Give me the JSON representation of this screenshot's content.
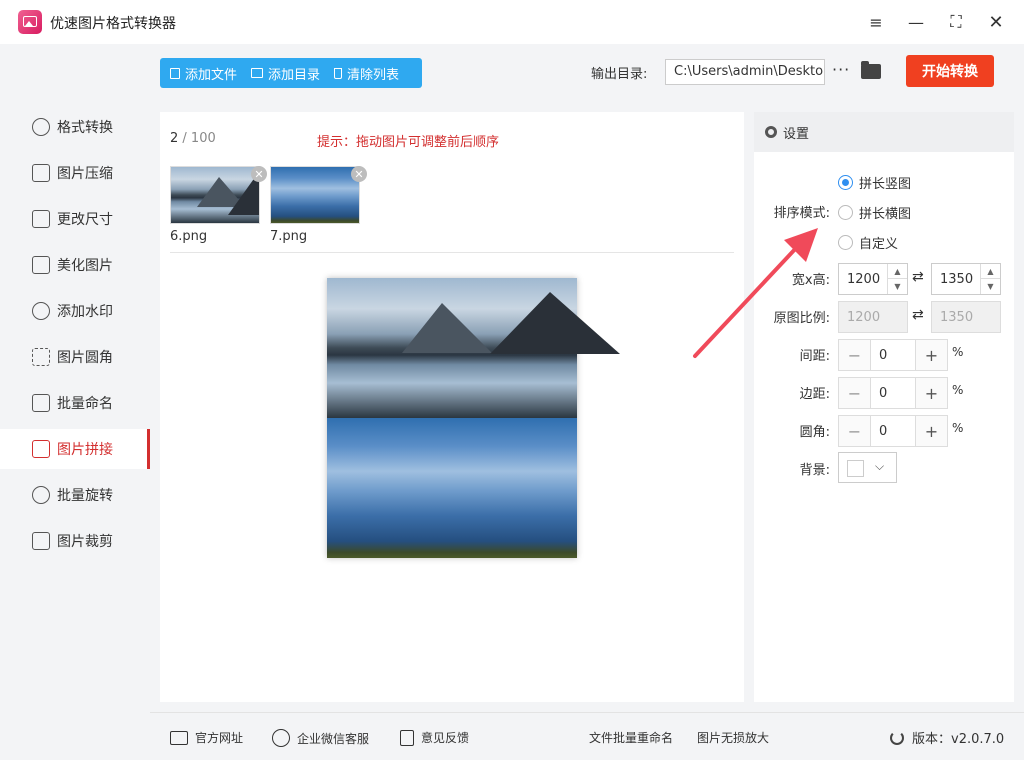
{
  "app": {
    "title": "优速图片格式转换器"
  },
  "window": {
    "menu": "≡",
    "minimize": "—",
    "maximize": "⛶",
    "close": "✕"
  },
  "sidebar": {
    "items": [
      {
        "label": "格式转换",
        "icon": "format-convert-icon"
      },
      {
        "label": "图片压缩",
        "icon": "compress-icon"
      },
      {
        "label": "更改尺寸",
        "icon": "resize-icon"
      },
      {
        "label": "美化图片",
        "icon": "beautify-icon"
      },
      {
        "label": "添加水印",
        "icon": "watermark-icon"
      },
      {
        "label": "图片圆角",
        "icon": "rounded-corner-icon"
      },
      {
        "label": "批量命名",
        "icon": "rename-icon"
      },
      {
        "label": "图片拼接",
        "icon": "stitch-icon",
        "active": true
      },
      {
        "label": "批量旋转",
        "icon": "rotate-icon"
      },
      {
        "label": "图片裁剪",
        "icon": "crop-icon"
      }
    ]
  },
  "toolbar": {
    "add_file": "添加文件",
    "add_folder": "添加目录",
    "clear_list": "清除列表",
    "output_label": "输出目录:",
    "output_path": "C:\\Users\\admin\\Deskto",
    "more": "···",
    "start": "开始转换"
  },
  "main": {
    "count_current": "2",
    "count_total": "/ 100",
    "hint": "提示：拖动图片可调整前后顺序",
    "files": [
      {
        "name": "6.png"
      },
      {
        "name": "7.png"
      }
    ],
    "close_glyph": "✕"
  },
  "settings": {
    "title": "设置",
    "sort_mode_label": "排序模式:",
    "modes": [
      {
        "label": "拼长竖图",
        "selected": true
      },
      {
        "label": "拼长横图",
        "selected": false
      },
      {
        "label": "自定义",
        "selected": false
      }
    ],
    "size_label": "宽x高:",
    "width": "1200",
    "height": "1350",
    "ratio_label": "原图比例:",
    "ratio_width": "1200",
    "ratio_height": "1350",
    "spacing_label": "间距:",
    "spacing": "0",
    "margin_label": "边距:",
    "margin": "0",
    "radius_label": "圆角:",
    "radius": "0",
    "percent": "%",
    "bg_label": "背景:",
    "bg_color": "#ffffff",
    "minus": "−",
    "plus": "+",
    "swap": "⇄",
    "chevron": "⌵"
  },
  "footer": {
    "website": "官方网址",
    "wechat": "企业微信客服",
    "feedback": "意见反馈",
    "batch_rename": "文件批量重命名",
    "lossless": "图片无损放大",
    "version": "版本：v2.0.7.0"
  },
  "colors": {
    "accent": "#2fa9f0",
    "start": "#f04020",
    "active_nav": "#d32f2f",
    "arrow": "#f04a5a"
  }
}
